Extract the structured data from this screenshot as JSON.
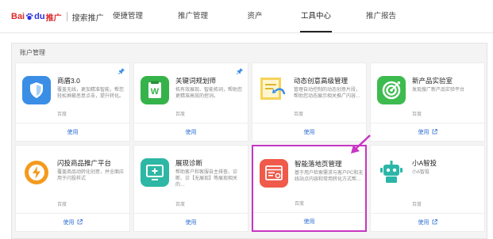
{
  "header": {
    "logo": {
      "bai": "Bai",
      "du": "du",
      "tuiguang": "推广",
      "subtitle": "搜索推广"
    },
    "nav": [
      {
        "label": "便捷管理",
        "active": false
      },
      {
        "label": "推广管理",
        "active": false
      },
      {
        "label": "资产",
        "active": false
      },
      {
        "label": "工具中心",
        "active": true
      },
      {
        "label": "推广报告",
        "active": false
      }
    ]
  },
  "section": {
    "title": "账户管理",
    "cards": [
      {
        "title": "商盾3.0",
        "desc": "覆盖无线，更加精准智能，帮您轻松屏蔽恶意点击，提升转化。",
        "vendor": "百度",
        "action": "使用",
        "external": false,
        "pinned": true,
        "icon": "shield-icon",
        "icon_color": "#3a8ee6",
        "highlight": false
      },
      {
        "title": "关键词规划师",
        "desc": "拓有效展现、智能拓词，帮助您更精准高效的挖词。",
        "vendor": "百度",
        "action": "使用",
        "external": false,
        "pinned": true,
        "icon": "document-w-icon",
        "icon_color": "#35b34a",
        "highlight": false
      },
      {
        "title": "动态创意高级管理",
        "desc": "管理自动控制的动态创意片段，帮助您动态展示相关推广内容…",
        "vendor": "百度",
        "action": "使用",
        "external": false,
        "pinned": false,
        "icon": "creative-image-icon",
        "icon_color": "#f6d35a",
        "highlight": false
      },
      {
        "title": "新产品实验室",
        "desc": "发现搜广新产品实验平台",
        "vendor": "百度",
        "action": "使用",
        "external": true,
        "pinned": false,
        "icon": "target-icon",
        "icon_color": "#3dbb4e",
        "highlight": false
      },
      {
        "title": "闪投商品推广平台",
        "desc": "覆盖商品动转化创意，并全面应用于闪投样式",
        "vendor": "百度",
        "action": "使用",
        "external": true,
        "pinned": false,
        "icon": "flash-icon",
        "icon_color": "#f39a1e",
        "highlight": false
      },
      {
        "title": "展现诊断",
        "desc": "帮助客户和客服自主排查、诊断、诊【无展现】等展现相关的…",
        "vendor": "百度",
        "action": "使用",
        "external": false,
        "pinned": false,
        "icon": "monitor-plus-icon",
        "icon_color": "#2db7a4",
        "highlight": false
      },
      {
        "title": "智能落地页管理",
        "desc": "基于用户检索需求与客户PC和无线站点内容和常用转化方式帮…",
        "vendor": "百度",
        "action": "使用",
        "external": false,
        "pinned": false,
        "icon": "landing-page-icon",
        "icon_color": "#ef5a4a",
        "highlight": true
      },
      {
        "title": "小A智投",
        "desc": "小A智投",
        "vendor": "百度",
        "action": "使用",
        "external": true,
        "pinned": false,
        "icon": "robot-icon",
        "icon_color": "#2bb6a8",
        "highlight": false
      }
    ]
  },
  "colors": {
    "accent": "#2f6fd6",
    "highlight_border": "#c736c3",
    "active_nav_underline": "#222222"
  }
}
